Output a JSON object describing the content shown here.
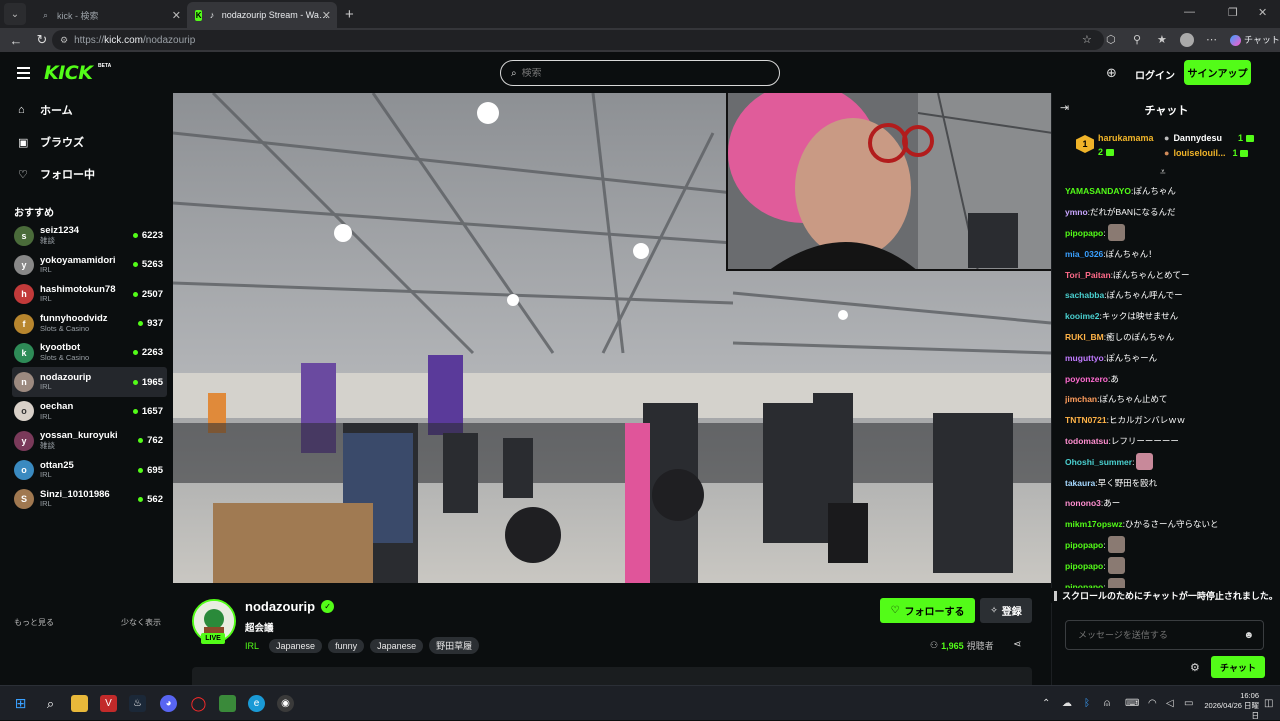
{
  "browser": {
    "tabs": [
      {
        "title": "kick - 検索",
        "active": false
      },
      {
        "title": "nodazourip Stream - Watch Live on Kick",
        "active": true
      }
    ],
    "url_scheme": "https://",
    "url_host": "kick.com",
    "url_path": "/nodazourip",
    "profile_label": "チャット"
  },
  "header": {
    "logo": "KICK",
    "beta": "BETA",
    "search_placeholder": "検索",
    "login": "ログイン",
    "signup": "サインアップ"
  },
  "sidebar": {
    "nav": [
      {
        "label": "ホーム",
        "icon": "home-icon"
      },
      {
        "label": "ブラウズ",
        "icon": "browse-icon"
      },
      {
        "label": "フォロー中",
        "icon": "heart-icon"
      }
    ],
    "recommended_title": "おすすめ",
    "channels": [
      {
        "name": "seiz1234",
        "category": "雑談",
        "viewers": "6223",
        "color": "#4a6b3a"
      },
      {
        "name": "yokoyamamidori",
        "category": "IRL",
        "viewers": "5263",
        "color": "#888888"
      },
      {
        "name": "hashimotokun78",
        "category": "IRL",
        "viewers": "2507",
        "color": "#c23a3a"
      },
      {
        "name": "funnyhoodvidz",
        "category": "Slots & Casino",
        "viewers": "937",
        "color": "#b8862e"
      },
      {
        "name": "kyootbot",
        "category": "Slots & Casino",
        "viewers": "2263",
        "color": "#2e8b57"
      },
      {
        "name": "nodazourip",
        "category": "IRL",
        "viewers": "1965",
        "color": "#9c8a80"
      },
      {
        "name": "oechan",
        "category": "IRL",
        "viewers": "1657",
        "color": "#d8d0c8"
      },
      {
        "name": "yossan_kuroyuki",
        "category": "雑談",
        "viewers": "762",
        "color": "#7a3a5a"
      },
      {
        "name": "ottan25",
        "category": "IRL",
        "viewers": "695",
        "color": "#3a8ac0"
      },
      {
        "name": "Sinzi_10101986",
        "category": "IRL",
        "viewers": "562",
        "color": "#a07850"
      }
    ],
    "show_more": "もっと見る",
    "show_less": "少なく表示"
  },
  "stream": {
    "channel": "nodazourip",
    "live": "LIVE",
    "title": "超会議",
    "category": "IRL",
    "tags": [
      "Japanese",
      "funny",
      "Japanese",
      "野田草履"
    ],
    "follow": "フォローする",
    "subscribe": "登録",
    "viewer_count": "1,965",
    "viewer_label": "視聴者"
  },
  "chat": {
    "title": "チャット",
    "gifters": [
      {
        "name": "harukamama",
        "count": "2",
        "color": "#f0b429"
      },
      {
        "name": "Dannydesu",
        "count": "1",
        "color": "#ffffff"
      },
      {
        "name": "louiselouil...",
        "count": "1",
        "color": "#f0b429"
      }
    ],
    "rank_label": "1",
    "messages": [
      {
        "user": "YAMASANDAYO",
        "color": "#53fc18",
        "text": "ぽんちゃん",
        "emote": ""
      },
      {
        "user": "ymno",
        "color": "#c9a6ff",
        "text": "だれがBANになるんだ",
        "emote": ""
      },
      {
        "user": "pipopapo",
        "color": "#53fc18",
        "text": "",
        "emote": "emote"
      },
      {
        "user": "mia_0326",
        "color": "#3aa0ff",
        "text": "ぽんちゃん！",
        "emote": ""
      },
      {
        "user": "Tori_Paitan",
        "color": "#ff6b8a",
        "text": "ぽんちゃんとめてー",
        "emote": ""
      },
      {
        "user": "sachabba",
        "color": "#4ad0d0",
        "text": "ぽんちゃん呼んでー",
        "emote": ""
      },
      {
        "user": "kooime2",
        "color": "#4ad0d0",
        "text": "キックは映せません",
        "emote": ""
      },
      {
        "user": "RUKI_BM",
        "color": "#ffb347",
        "text": "癒しのぽんちゃん",
        "emote": ""
      },
      {
        "user": "muguttyo",
        "color": "#c07aff",
        "text": "ぽんちゃーん",
        "emote": ""
      },
      {
        "user": "poyonzero",
        "color": "#ff6bd0",
        "text": "あ",
        "emote": ""
      },
      {
        "user": "jimchan",
        "color": "#ff9d5c",
        "text": "ぽんちゃん止めて",
        "emote": ""
      },
      {
        "user": "TNTN0721",
        "color": "#ffb347",
        "text": "ヒカルガンバレｗｗ",
        "emote": ""
      },
      {
        "user": "todomatsu",
        "color": "#ff8fd0",
        "text": "レフリーーーーー",
        "emote": ""
      },
      {
        "user": "Ohoshi_summer",
        "color": "#4ad0d0",
        "text": "",
        "emote": "emote-pink"
      },
      {
        "user": "takaura",
        "color": "#a6d8ff",
        "text": "早く野田を殴れ",
        "emote": ""
      },
      {
        "user": "nonono3",
        "color": "#ff8fd0",
        "text": "あー",
        "emote": ""
      },
      {
        "user": "mikm17opswz",
        "color": "#53fc18",
        "text": "ひかるさーん守らないと",
        "emote": ""
      },
      {
        "user": "pipopapo",
        "color": "#53fc18",
        "text": "",
        "emote": "emote"
      },
      {
        "user": "pipopapo",
        "color": "#53fc18",
        "text": "",
        "emote": "emote"
      },
      {
        "user": "pipopapo",
        "color": "#53fc18",
        "text": "",
        "emote": "emote"
      }
    ],
    "paused_notice": "スクロールのためにチャットが一時停止されました。",
    "input_placeholder": "メッセージを送信する",
    "send": "チャット"
  },
  "taskbar": {
    "time": "16:06",
    "date": "2026/04/26 日曜日"
  }
}
